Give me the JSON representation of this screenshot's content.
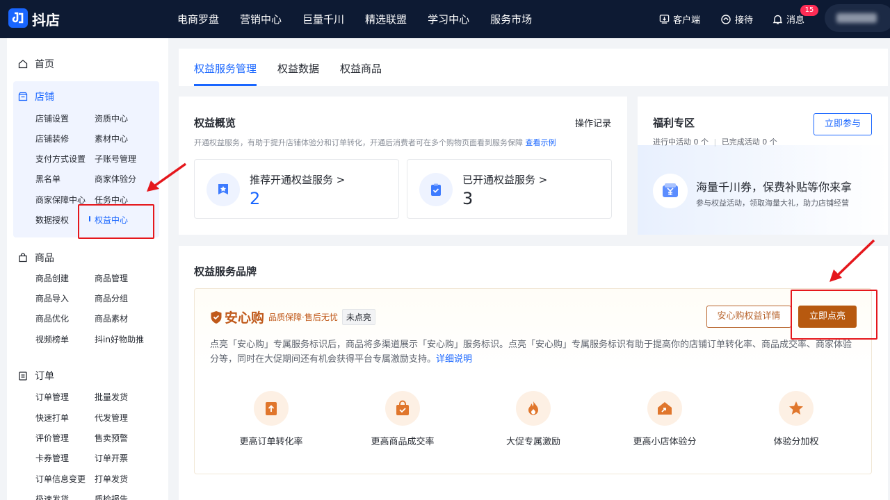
{
  "header": {
    "logo_text": "抖店",
    "nav": [
      "电商罗盘",
      "营销中心",
      "巨量千川",
      "精选联盟",
      "学习中心",
      "服务市场"
    ],
    "client_label": "客户端",
    "reception_label": "接待",
    "message_label": "消息",
    "message_badge": "15"
  },
  "sidebar": {
    "home": "首页",
    "store": {
      "title": "店铺",
      "links": [
        "店铺设置",
        "资质中心",
        "店铺装修",
        "素材中心",
        "支付方式设置",
        "子账号管理",
        "黑名单",
        "商家体验分",
        "商家保障中心",
        "任务中心",
        "数据授权",
        "权益中心"
      ]
    },
    "goods": {
      "title": "商品",
      "links": [
        "商品创建",
        "商品管理",
        "商品导入",
        "商品分组",
        "商品优化",
        "商品素材",
        "视频榜单",
        "抖in好物助推"
      ]
    },
    "orders": {
      "title": "订单",
      "links": [
        "订单管理",
        "批量发货",
        "快速打单",
        "代发管理",
        "评价管理",
        "售卖预警",
        "卡券管理",
        "订单开票",
        "订单信息变更",
        "打单发货",
        "极速发货",
        "质检报告"
      ]
    }
  },
  "tabs": [
    "权益服务管理",
    "权益数据",
    "权益商品"
  ],
  "overview": {
    "title": "权益概览",
    "desc": "开通权益服务，有助于提升店铺体验分和订单转化，开通后消费者可在多个购物页面看到服务保障",
    "desc_link": "查看示例",
    "op_record": "操作记录",
    "recommend_label": "推荐开通权益服务 >",
    "recommend_value": "2",
    "opened_label": "已开通权益服务 >",
    "opened_value": "3"
  },
  "welfare": {
    "title": "福利专区",
    "ongoing": "进行中活动 0 个",
    "completed": "已完成活动 0 个",
    "join_button": "立即参与",
    "coupon_title": "海量千川券，保费补贴等你来拿",
    "coupon_desc": "参与权益活动，领取海量大礼，助力店铺经营"
  },
  "brand": {
    "title": "权益服务品牌",
    "name": "安心购",
    "slogan": "品质保障·售后无忧",
    "status_tag": "未点亮",
    "detail_button": "安心购权益详情",
    "light_button": "立即点亮",
    "desc": "点亮「安心购」专属服务标识后，商品将多渠道展示「安心购」服务标识。点亮「安心购」专属服务标识有助于提高你的店铺订单转化率、商品成交率、商家体验分等，同时在大促期间还有机会获得平台专属激励支持。",
    "desc_link": "详细说明",
    "features": [
      {
        "icon": "order-up-icon",
        "label": "更高订单转化率"
      },
      {
        "icon": "bag-check-icon",
        "label": "更高商品成交率"
      },
      {
        "icon": "flame-icon",
        "label": "大促专属激励"
      },
      {
        "icon": "shop-up-icon",
        "label": "更高小店体验分"
      },
      {
        "icon": "star-icon",
        "label": "体验分加权"
      }
    ]
  },
  "colors": {
    "brand_blue": "#1966ff",
    "header_bg": "#0d1a33",
    "axg_brown": "#b7590f",
    "annotation_red": "#e5171c"
  }
}
